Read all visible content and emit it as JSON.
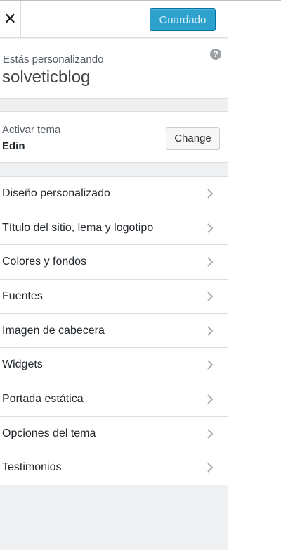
{
  "header": {
    "close_icon": "close-icon",
    "save_label": "Guardado",
    "save_color": "#2ea2cc"
  },
  "info": {
    "subtitle": "Estás personalizando",
    "title": "solveticblog",
    "help_icon": "help-circle-icon",
    "help_glyph": "?"
  },
  "theme": {
    "subtitle": "Activar tema",
    "name": "Edin",
    "change_label": "Change"
  },
  "menu": {
    "items": [
      {
        "label": "Diseño personalizado"
      },
      {
        "label": "Título del sitio, lema y logotipo"
      },
      {
        "label": "Colores y fondos"
      },
      {
        "label": "Fuentes"
      },
      {
        "label": "Imagen de cabecera"
      },
      {
        "label": "Widgets"
      },
      {
        "label": "Portada estática"
      },
      {
        "label": "Opciones del tema"
      },
      {
        "label": "Testimonios"
      }
    ],
    "chevron_icon": "chevron-right-icon"
  }
}
